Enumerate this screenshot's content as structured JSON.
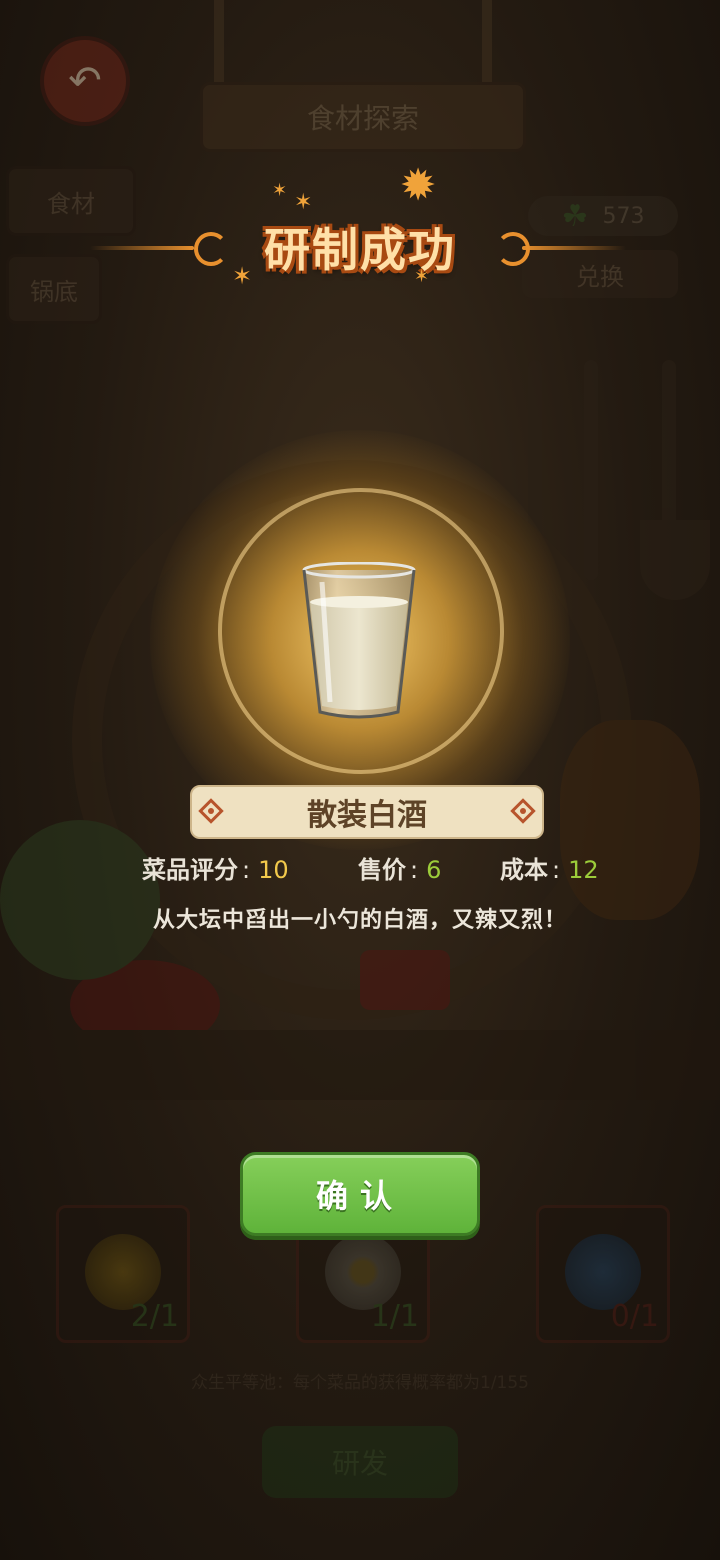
{
  "background": {
    "sign_title": "食材探索",
    "tabs": [
      "食材",
      "锅底"
    ],
    "clover_count": "573",
    "exchange_label": "兑换",
    "slots": [
      {
        "count": "2/1",
        "orb_color": "#c9a020"
      },
      {
        "count": "1/1",
        "orb_color": "#d8d4c0"
      },
      {
        "count": "0/1",
        "orb_color": "#2a6ea8"
      }
    ],
    "hint": "众生平等池：每个菜品的获得概率都为1/155",
    "develop_label": "研发"
  },
  "popup": {
    "title": "研制成功",
    "dish_name": "散装白酒",
    "stats": [
      {
        "label": "菜品评分",
        "value": "10",
        "value_color": "#f2c94c"
      },
      {
        "label": "售价",
        "value": "6",
        "value_color": "#9ccc3a"
      },
      {
        "label": "成本",
        "value": "12",
        "value_color": "#9ccc3a"
      }
    ],
    "separator": ":",
    "description": "从大坛中舀出一小勺的白酒，又辣又烈！",
    "confirm_label": "确认"
  },
  "icons": {
    "back": "back-arrow-icon",
    "clover": "clover-icon",
    "dish": "liquor-glass-icon",
    "stars": "star-icon",
    "sunburst": "sunburst-icon"
  },
  "colors": {
    "title_fill": "#ffe0a8",
    "title_outline": "#a84a12",
    "accent_orange": "#e8902e",
    "button_green": "#6cbf45",
    "plate": "#efe1c1"
  }
}
